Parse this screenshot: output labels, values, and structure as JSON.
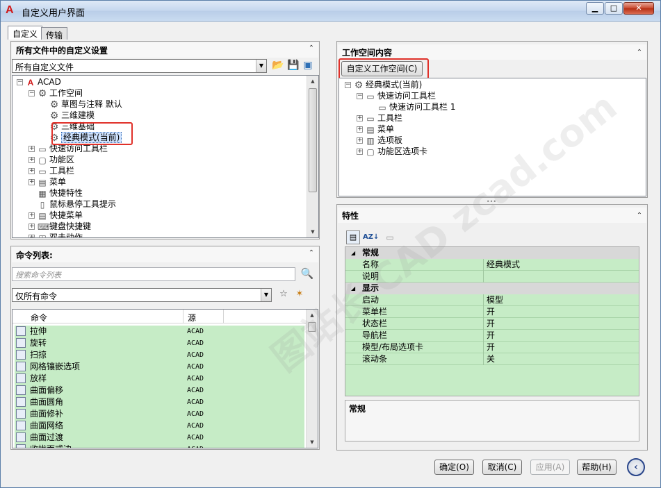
{
  "window": {
    "title": "自定义用户界面",
    "minimize": "▁",
    "maximize": "□",
    "close": "✕"
  },
  "tabs": [
    "自定义",
    "传输"
  ],
  "left_top_pane": {
    "title": "所有文件中的自定义设置",
    "dropdown_value": "所有自定义文件",
    "tree": [
      {
        "label": "ACAD",
        "indent": 0,
        "expander": "−",
        "icon": "acad-logo-icon"
      },
      {
        "label": "工作空间",
        "indent": 1,
        "expander": "−",
        "icon": "gear-icon"
      },
      {
        "label": "草图与注释 默认",
        "indent": 2,
        "expander": "",
        "icon": "gear-icon"
      },
      {
        "label": "三维建模",
        "indent": 2,
        "expander": "",
        "icon": "gear-icon"
      },
      {
        "label": "三维基础",
        "indent": 2,
        "expander": "",
        "icon": "gear-icon"
      },
      {
        "label": "经典模式(当前)",
        "indent": 2,
        "expander": "",
        "icon": "gear-icon",
        "selected": true
      },
      {
        "label": "快速访问工具栏",
        "indent": 1,
        "expander": "+",
        "icon": "toolbar-icon"
      },
      {
        "label": "功能区",
        "indent": 1,
        "expander": "+",
        "icon": "ribbon-icon"
      },
      {
        "label": "工具栏",
        "indent": 1,
        "expander": "+",
        "icon": "toolbar-icon"
      },
      {
        "label": "菜单",
        "indent": 1,
        "expander": "+",
        "icon": "menu-icon"
      },
      {
        "label": "快捷特性",
        "indent": 1,
        "expander": "",
        "icon": "properties-icon"
      },
      {
        "label": "鼠标悬停工具提示",
        "indent": 1,
        "expander": "",
        "icon": "tooltip-icon"
      },
      {
        "label": "快捷菜单",
        "indent": 1,
        "expander": "+",
        "icon": "menu-icon"
      },
      {
        "label": "键盘快捷键",
        "indent": 1,
        "expander": "+",
        "icon": "keyboard-icon"
      },
      {
        "label": "双击动作",
        "indent": 1,
        "expander": "+",
        "icon": "mouse-icon"
      }
    ]
  },
  "command_pane": {
    "title": "命令列表:",
    "search_placeholder": "搜索命令列表",
    "filter_value": "仅所有命令",
    "columns": [
      "命令",
      "源"
    ],
    "rows": [
      {
        "name": "拉伸",
        "source": "ACAD"
      },
      {
        "name": "旋转",
        "source": "ACAD"
      },
      {
        "name": "扫掠",
        "source": "ACAD"
      },
      {
        "name": "网格镶嵌选项",
        "source": "ACAD"
      },
      {
        "name": "放样",
        "source": "ACAD"
      },
      {
        "name": "曲面偏移",
        "source": "ACAD"
      },
      {
        "name": "曲面圆角",
        "source": "ACAD"
      },
      {
        "name": "曲面修补",
        "source": "ACAD"
      },
      {
        "name": "曲面网络",
        "source": "ACAD"
      },
      {
        "name": "曲面过渡",
        "source": "ACAD"
      },
      {
        "name": "收拢面或边",
        "source": "ACAD"
      }
    ]
  },
  "workspace_pane": {
    "title": "工作空间内容",
    "customize_button": "自定义工作空间(C)",
    "tree": [
      {
        "label": "经典模式(当前)",
        "indent": 0,
        "expander": "−",
        "icon": "gear-icon"
      },
      {
        "label": "快速访问工具栏",
        "indent": 1,
        "expander": "−",
        "icon": "toolbar-icon"
      },
      {
        "label": "快速访问工具栏 1",
        "indent": 2,
        "expander": "",
        "icon": "toolbar-icon"
      },
      {
        "label": "工具栏",
        "indent": 1,
        "expander": "+",
        "icon": "toolbar-icon"
      },
      {
        "label": "菜单",
        "indent": 1,
        "expander": "+",
        "icon": "menu-icon"
      },
      {
        "label": "选项板",
        "indent": 1,
        "expander": "+",
        "icon": "palette-icon"
      },
      {
        "label": "功能区选项卡",
        "indent": 1,
        "expander": "+",
        "icon": "ribbon-icon"
      }
    ]
  },
  "properties_pane": {
    "title": "特性",
    "rows": [
      {
        "type": "cat",
        "label": "常规"
      },
      {
        "type": "data",
        "key": "名称",
        "value": "经典模式"
      },
      {
        "type": "data",
        "key": "说明",
        "value": ""
      },
      {
        "type": "cat",
        "label": "显示"
      },
      {
        "type": "data",
        "key": "启动",
        "value": "模型"
      },
      {
        "type": "data",
        "key": "菜单栏",
        "value": "开"
      },
      {
        "type": "data",
        "key": "状态栏",
        "value": "开"
      },
      {
        "type": "data",
        "key": "导航栏",
        "value": "开"
      },
      {
        "type": "data",
        "key": "模型/布局选项卡",
        "value": "开"
      },
      {
        "type": "data",
        "key": "滚动条",
        "value": "关"
      }
    ],
    "description_title": "常规"
  },
  "footer": {
    "ok": "确定(O)",
    "cancel": "取消(C)",
    "apply": "应用(A)",
    "help": "帮助(H)"
  },
  "watermark": "图站长 CAD zcad.com"
}
